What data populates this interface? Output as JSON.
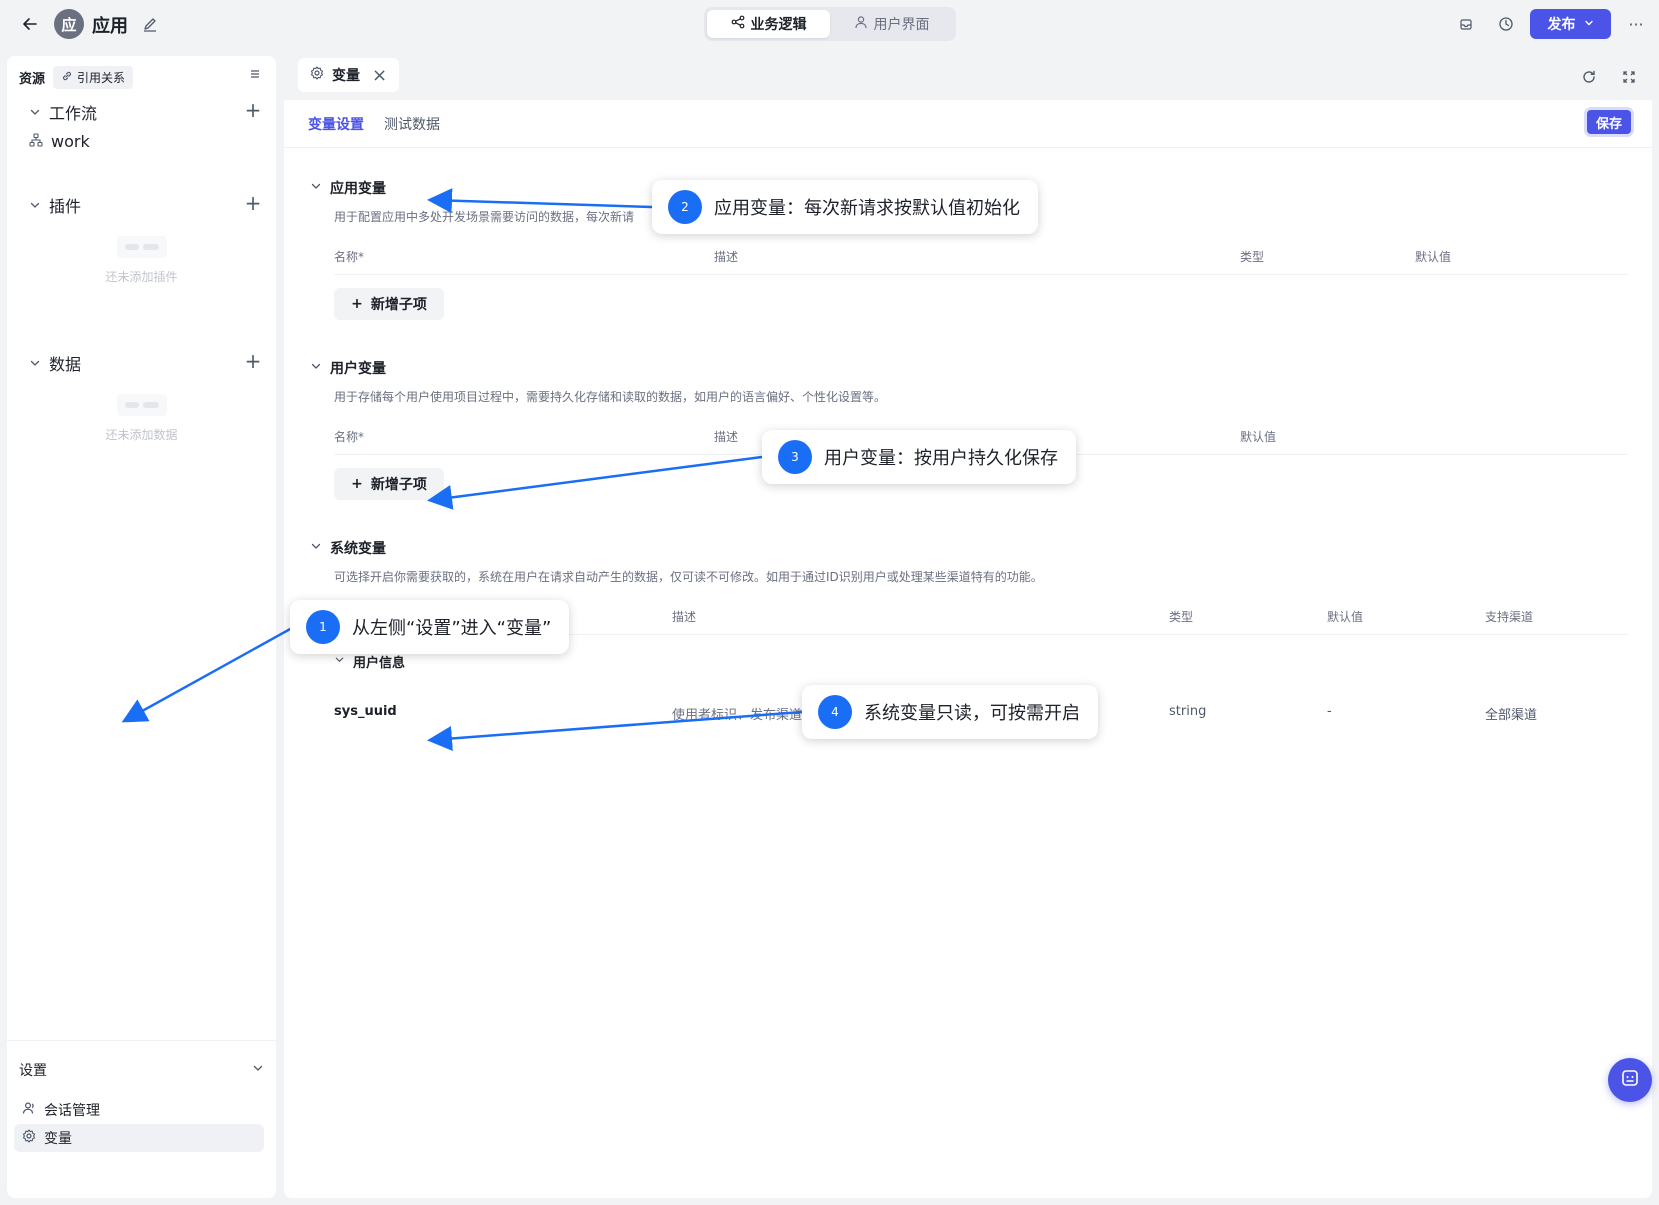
{
  "header": {
    "app_initial": "应",
    "app_title": "应用",
    "mode_tabs": [
      {
        "label": "业务逻辑",
        "active": true
      },
      {
        "label": "用户界面",
        "active": false
      }
    ],
    "publish_label": "发布",
    "more_label": "···"
  },
  "sidebar": {
    "resources_label": "资源",
    "references_label": "引用关系",
    "sections": [
      {
        "label": "工作流",
        "items": [
          "work"
        ],
        "empty_text": ""
      },
      {
        "label": "插件",
        "items": [],
        "empty_text": "还未添加插件"
      },
      {
        "label": "数据",
        "items": [],
        "empty_text": "还未添加数据"
      }
    ],
    "settings": {
      "label": "设置",
      "items": [
        {
          "label": "会话管理",
          "active": false
        },
        {
          "label": "变量",
          "active": true
        }
      ]
    }
  },
  "main": {
    "file_tab": "变量",
    "subtabs": [
      {
        "label": "变量设置",
        "active": true
      },
      {
        "label": "测试数据",
        "active": false
      }
    ],
    "save_label": "保存",
    "sections": {
      "app": {
        "title": "应用变量",
        "desc": "用于配置应用中多处开发场景需要访问的数据，每次新请",
        "columns": [
          "名称*",
          "描述",
          "类型",
          "默认值"
        ],
        "add_label": "新增子项"
      },
      "user": {
        "title": "用户变量",
        "desc": "用于存储每个用户使用项目过程中，需要持久化存储和读取的数据，如用户的语言偏好、个性化设置等。",
        "columns": [
          "名称*",
          "描述",
          "默认值"
        ],
        "add_label": "新增子项"
      },
      "system": {
        "title": "系统变量",
        "desc": "可选择开启你需要获取的，系统在用户在请求自动产生的数据，仅可读不可修改。如用于通过ID识别用户或处理某些渠道特有的功能。",
        "columns": [
          "描述",
          "类型",
          "默认值",
          "支持渠道"
        ],
        "group_label": "用户信息",
        "rows": [
          {
            "name": "sys_uuid",
            "desc": "使用者标识、发布渠道",
            "type": "string",
            "default": "-",
            "channel": "全部渠道"
          }
        ]
      }
    }
  },
  "annotations": [
    {
      "num": "1",
      "text": "从左侧“设置”进入“变量”"
    },
    {
      "num": "2",
      "text": "应用变量：每次新请求按默认值初始化"
    },
    {
      "num": "3",
      "text": "用户变量：按用户持久化保存"
    },
    {
      "num": "4",
      "text": "系统变量只读，可按需开启"
    }
  ],
  "colors": {
    "accent": "#4c54e8",
    "annotation": "#1a6ef5"
  }
}
